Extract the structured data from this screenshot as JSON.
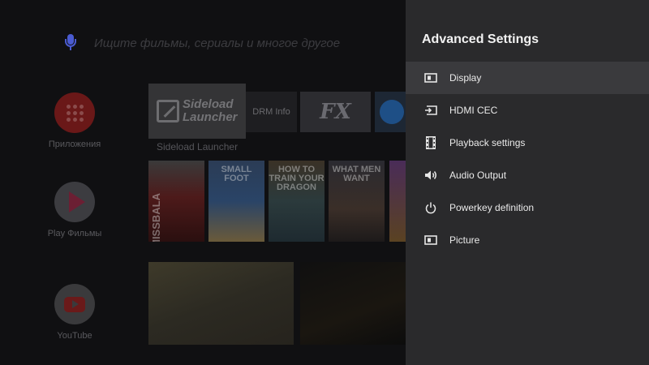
{
  "launcher": {
    "search_placeholder": "Ищите фильмы, сериалы и многое другое",
    "apps": [
      {
        "label": "Приложения",
        "icon": "apps-grid-icon"
      },
      {
        "label": "Play Фильмы",
        "icon": "play-movies-icon"
      },
      {
        "label": "YouTube",
        "icon": "youtube-icon"
      }
    ],
    "tiles": {
      "sideload_text": "Sideload Launcher",
      "sideload_label": "Sideload Launcher",
      "drm": "DRM Info",
      "fx": "FX"
    },
    "posters": [
      {
        "title": "MISSBALA"
      },
      {
        "title": "SMALL FOOT"
      },
      {
        "title": "HOW TO TRAIN YOUR DRAGON"
      },
      {
        "title": "WHAT MEN WANT"
      },
      {
        "title": ""
      }
    ]
  },
  "panel": {
    "title": "Advanced Settings",
    "items": [
      {
        "label": "Display",
        "icon": "display-icon"
      },
      {
        "label": "HDMI CEC",
        "icon": "hdmi-cec-icon"
      },
      {
        "label": "Playback settings",
        "icon": "film-strip-icon"
      },
      {
        "label": "Audio Output",
        "icon": "speaker-icon"
      },
      {
        "label": "Powerkey definition",
        "icon": "power-icon"
      },
      {
        "label": "Picture",
        "icon": "picture-icon"
      }
    ],
    "selected_index": 0
  },
  "colors": {
    "panel_bg": "#2a2a2c",
    "selected_row": "#3a3a3d",
    "mic_accent": "#4a5bd1"
  }
}
